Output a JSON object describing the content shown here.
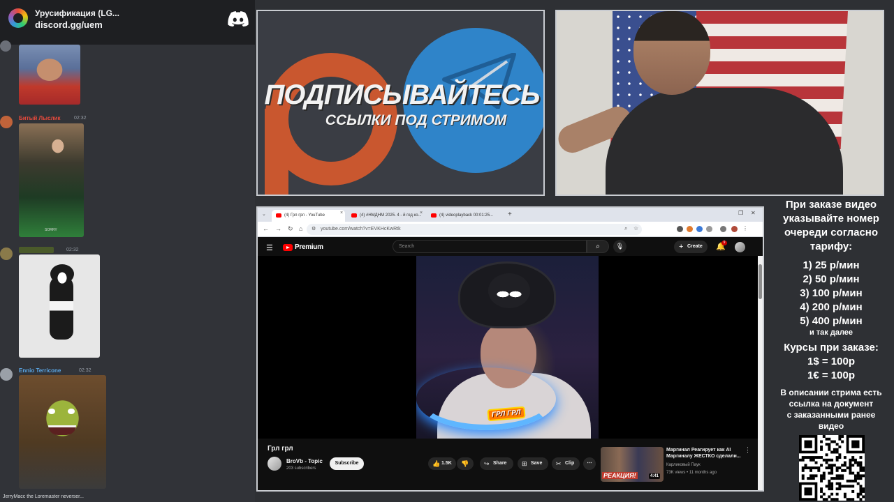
{
  "discord": {
    "server_name": "Урусификация (LG...",
    "server_link": "discord.gg/uem",
    "messages": [
      {
        "username": "",
        "timestamp": "",
        "name_color": "#f2f3f5"
      },
      {
        "username": "Битый Лыслик",
        "timestamp": "02:32",
        "name_color": "#e84a3c"
      },
      {
        "username": "",
        "timestamp": "02:32",
        "name_color": "#7a8a3c"
      },
      {
        "username": "Ennio Terricone",
        "timestamp": "02:32",
        "name_color": "#5aa7e6"
      }
    ],
    "bottom_user": "JerryMacc the Loremaster neverser...",
    "media_caption": "SORRY"
  },
  "promo": {
    "title": "ПОДПИСЫВАЙТЕСЬ",
    "subtitle": "ССЫЛКИ ПОД СТРИМОМ"
  },
  "browser": {
    "tabs": [
      {
        "label": "(4) Грл грл - YouTube"
      },
      {
        "label": "(4) #НМДНМ 2025. 4 - й год ко..."
      },
      {
        "label": "(4) videoplayback 00:01:25..."
      }
    ],
    "url": "youtube.com/watch?v=EVKHcKwRtk"
  },
  "youtube": {
    "brand": "Premium",
    "search_placeholder": "Search",
    "create_label": "Create",
    "notification_count": "9",
    "video_title": "Грл грл",
    "channel_name": "BroVb - Topic",
    "channel_subs": "203 subscribers",
    "subscribe_label": "Subscribe",
    "like_count": "1.5K",
    "share_label": "Share",
    "save_label": "Save",
    "clip_label": "Clip",
    "sticker_text": "ГРЛ ГРЛ",
    "recommended": {
      "title": "Маргинал Реагирует как AI Маргиналу ЖЕСТКО сделали...",
      "channel": "Карликовый Паук",
      "meta": "73K views • 11 months ago",
      "duration": "4:41",
      "thumb_label": "РЕАКЦИЯ!"
    }
  },
  "info": {
    "header_lines": [
      "При заказе видео",
      "указывайте номер",
      "очереди согласно",
      "тарифу:"
    ],
    "prices": [
      "1) 25 р/мин",
      "2) 50 р/мин",
      "3) 100 р/мин",
      "4) 200 р/мин",
      "5) 400 р/мин"
    ],
    "etc": "и так далее",
    "courses_title": "Курсы при заказе:",
    "courses": [
      "1$ = 100р",
      "1€ = 100р"
    ],
    "note_lines": [
      "В описании стрима есть",
      "ссылка на документ",
      "с заказанными ранее",
      "видео"
    ]
  },
  "colors": {
    "discord_bg": "#313338",
    "discord_header": "#1e1f22",
    "youtube_red": "#ff0000",
    "telegram_blue": "#2f84c9",
    "patreon_orange": "#c9572f"
  }
}
